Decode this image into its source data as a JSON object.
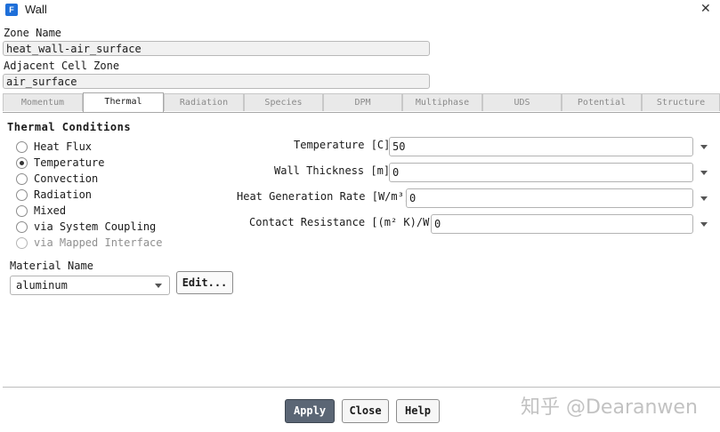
{
  "window": {
    "title": "Wall",
    "app_icon_letter": "F"
  },
  "zone": {
    "zone_name_label": "Zone Name",
    "zone_name_value": "heat_wall-air_surface",
    "adjacent_label": "Adjacent Cell Zone",
    "adjacent_value": "air_surface"
  },
  "tabs": [
    {
      "label": "Momentum",
      "active": false
    },
    {
      "label": "Thermal",
      "active": true
    },
    {
      "label": "Radiation",
      "active": false
    },
    {
      "label": "Species",
      "active": false
    },
    {
      "label": "DPM",
      "active": false
    },
    {
      "label": "Multiphase",
      "active": false
    },
    {
      "label": "UDS",
      "active": false
    },
    {
      "label": "Potential",
      "active": false
    },
    {
      "label": "Structure",
      "active": false
    }
  ],
  "thermal": {
    "section_title": "Thermal Conditions",
    "options": [
      {
        "label": "Heat Flux",
        "checked": false,
        "enabled": true
      },
      {
        "label": "Temperature",
        "checked": true,
        "enabled": true
      },
      {
        "label": "Convection",
        "checked": false,
        "enabled": true
      },
      {
        "label": "Radiation",
        "checked": false,
        "enabled": true
      },
      {
        "label": "Mixed",
        "checked": false,
        "enabled": true
      },
      {
        "label": "via System Coupling",
        "checked": false,
        "enabled": true
      },
      {
        "label": "via Mapped Interface",
        "checked": false,
        "enabled": false
      }
    ],
    "params": [
      {
        "label": "Temperature [C]",
        "value": "50"
      },
      {
        "label": "Wall Thickness [m]",
        "value": "0"
      },
      {
        "label": "Heat Generation Rate [W/m³]",
        "value": "0"
      },
      {
        "label": "Contact Resistance [(m² K)/W]",
        "value": "0"
      }
    ],
    "material_label": "Material Name",
    "material_value": "aluminum",
    "edit_label": "Edit..."
  },
  "buttons": {
    "apply": "Apply",
    "close": "Close",
    "help": "Help"
  },
  "watermark": "知乎 @Dearanwen",
  "colors": {
    "apply_bg": "#5b6675",
    "app_icon": "#1e6fd9"
  }
}
